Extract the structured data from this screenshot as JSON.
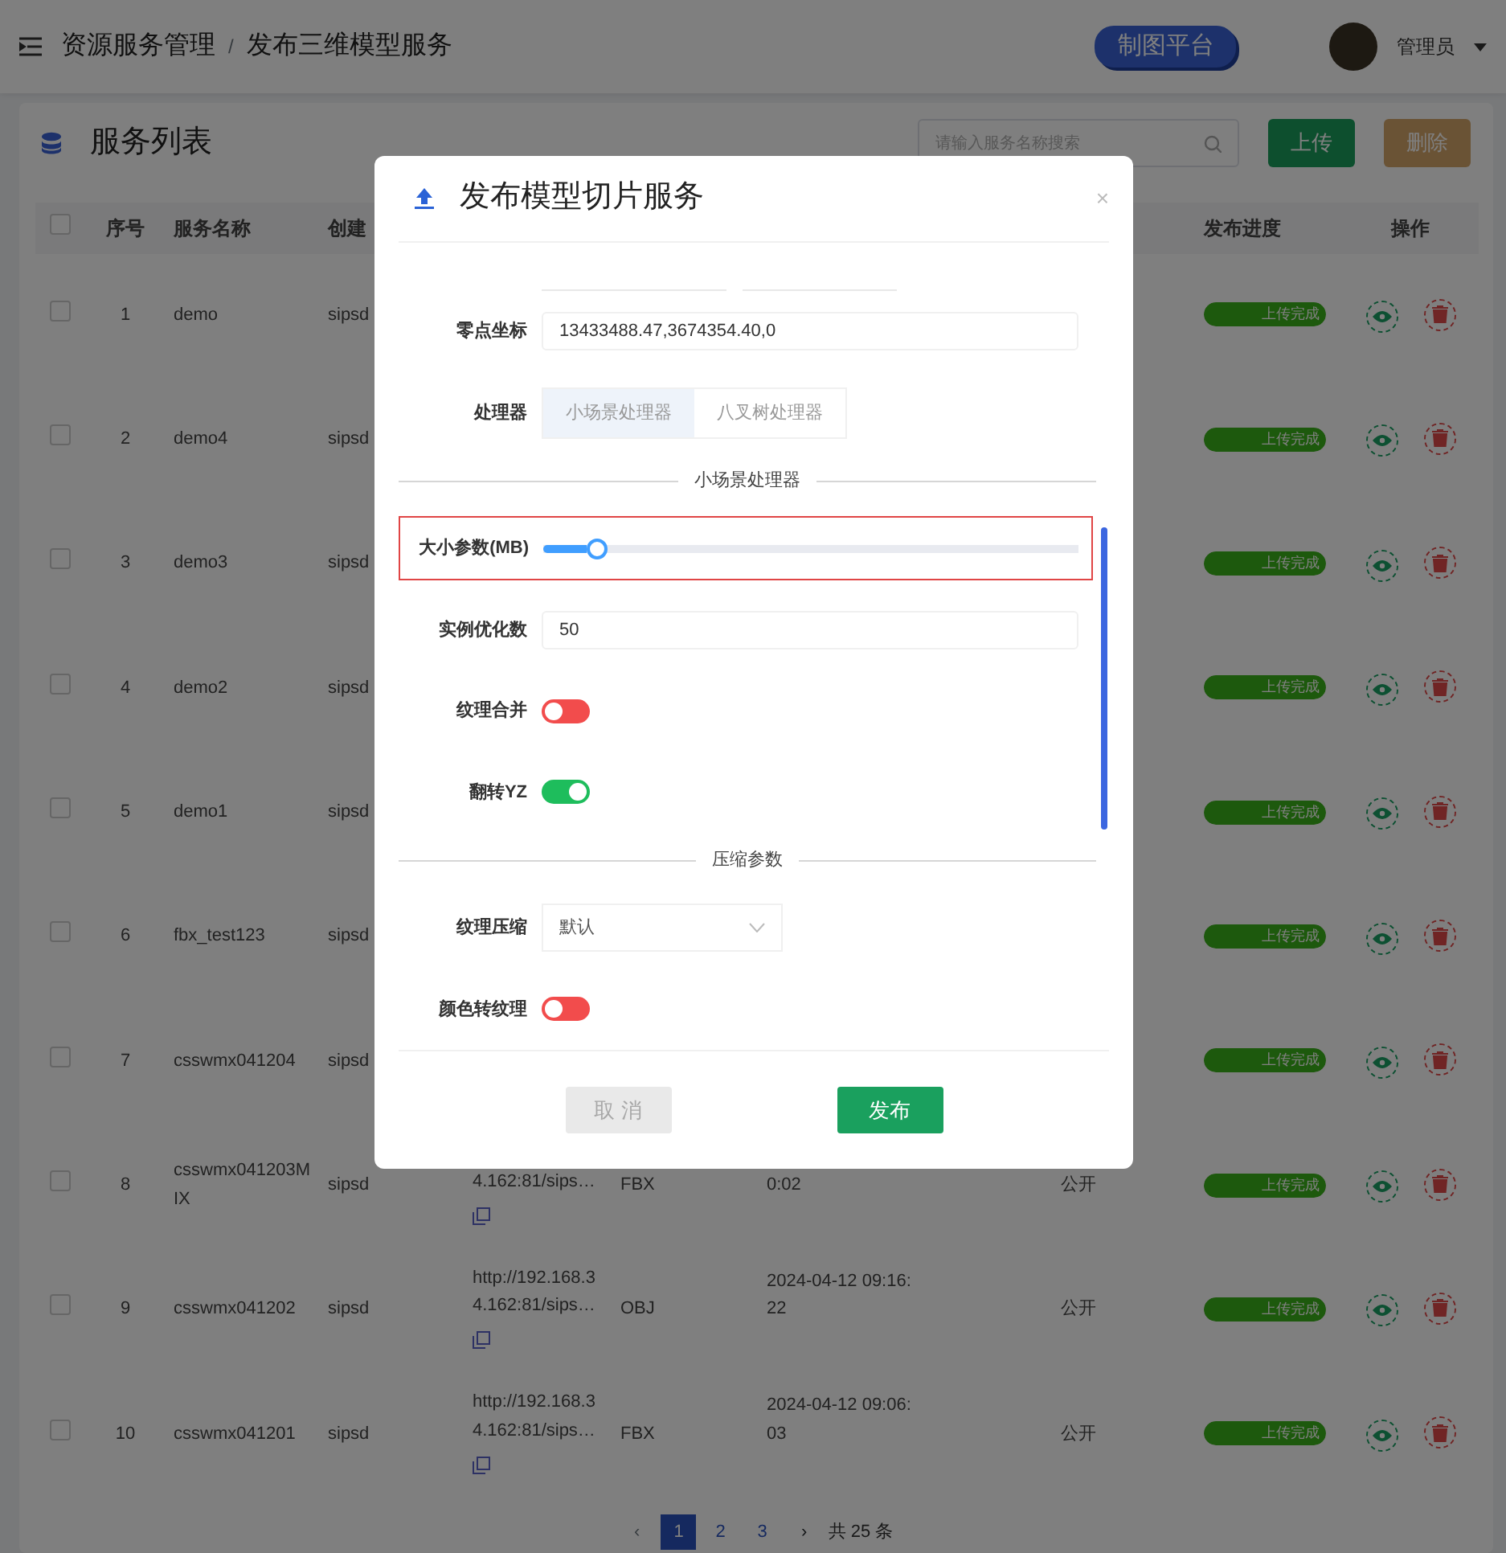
{
  "header": {
    "breadcrumb": [
      "资源服务管理",
      "发布三维模型服务"
    ],
    "separator": "/",
    "platform_badge": "制图平台",
    "user": "管理员"
  },
  "card": {
    "title": "服务列表",
    "search": {
      "placeholder": "请输入服务名称搜索"
    },
    "buttons": [
      {
        "label": "上传",
        "kind": "upload",
        "disabled": false
      },
      {
        "label": "删除",
        "kind": "delete",
        "disabled": true
      }
    ]
  },
  "table": {
    "select_all_checked": false,
    "columns": [
      "序号",
      "服务名称",
      "创建",
      "发布进度",
      "操作"
    ],
    "rows": [
      {
        "checked": false,
        "index": "1",
        "name": "demo",
        "creator": "sipsd",
        "progress": {
          "text": "上传完成",
          "level": 1
        }
      },
      {
        "checked": false,
        "index": "2",
        "name": "demo4",
        "creator": "sipsd",
        "progress": {
          "text": "上传完成",
          "level": 1
        }
      },
      {
        "checked": false,
        "index": "3",
        "name": "demo3",
        "creator": "sipsd",
        "progress": {
          "text": "上传完成",
          "level": 1
        }
      },
      {
        "checked": false,
        "index": "4",
        "name": "demo2",
        "creator": "sipsd",
        "progress": {
          "text": "上传完成",
          "level": 1
        }
      },
      {
        "checked": false,
        "index": "5",
        "name": "demo1",
        "creator": "sipsd",
        "progress": {
          "text": "上传完成",
          "level": 1
        }
      },
      {
        "checked": false,
        "index": "6",
        "name": "fbx_test123",
        "creator": "sipsd",
        "progress": {
          "text": "上传完成",
          "level": 1
        }
      },
      {
        "checked": false,
        "index": "7",
        "name": "csswmx041204",
        "creator": "sipsd",
        "progress": {
          "text": "上传完成",
          "level": 1
        }
      },
      {
        "checked": false,
        "index": "8",
        "name": "csswmx041203MIX",
        "creator": "sipsd",
        "url": "4.162:81/sips…",
        "type": "FBX",
        "date": "0:02",
        "visibility": "公开",
        "progress": {
          "text": "上传完成",
          "level": 1
        }
      },
      {
        "checked": false,
        "index": "9",
        "name": "csswmx041202",
        "creator": "sipsd",
        "url": "http://192.168.34.162:81/sips…",
        "type": "OBJ",
        "date": "2024-04-12 09:16:22",
        "visibility": "公开",
        "progress": {
          "text": "上传完成",
          "level": 1
        }
      },
      {
        "checked": false,
        "index": "10",
        "name": "csswmx041201",
        "creator": "sipsd",
        "url": "http://192.168.34.162:81/sips…",
        "type": "FBX",
        "date": "2024-04-12 09:06:03",
        "visibility": "公开",
        "progress": {
          "text": "上传完成",
          "level": 1
        }
      }
    ]
  },
  "pagination": {
    "prev": "‹",
    "next": "›",
    "pages": [
      {
        "label": "1",
        "selected": true
      },
      {
        "label": "2",
        "selected": false
      },
      {
        "label": "3",
        "selected": false
      }
    ],
    "total": "共 25 条"
  },
  "dialog": {
    "title": "发布模型切片服务",
    "close": "×",
    "form": [
      {
        "kind": "input",
        "label": "零点坐标",
        "value": "13433488.47,3674354.40,0"
      },
      {
        "kind": "segmented",
        "label": "处理器",
        "options": [
          {
            "label": "小场景处理器",
            "selected": true
          },
          {
            "label": "八叉树处理器",
            "selected": false
          }
        ]
      },
      {
        "kind": "divider",
        "label": "小场景处理器"
      },
      {
        "kind": "slider",
        "label": "大小参数(MB)",
        "level": 0.08,
        "highlighted": true
      },
      {
        "kind": "input",
        "label": "实例优化数",
        "value": "50"
      },
      {
        "kind": "switch",
        "label": "纹理合并",
        "on": false
      },
      {
        "kind": "switch",
        "label": "翻转YZ",
        "on": true
      },
      {
        "kind": "divider",
        "label": "压缩参数"
      },
      {
        "kind": "select",
        "label": "纹理压缩",
        "value": "默认"
      },
      {
        "kind": "switch",
        "label": "颜色转纹理",
        "on": false
      }
    ],
    "buttons": [
      {
        "label": "取 消",
        "kind": "cancel",
        "disabled": true
      },
      {
        "label": "发布",
        "kind": "publish",
        "disabled": false
      }
    ]
  }
}
